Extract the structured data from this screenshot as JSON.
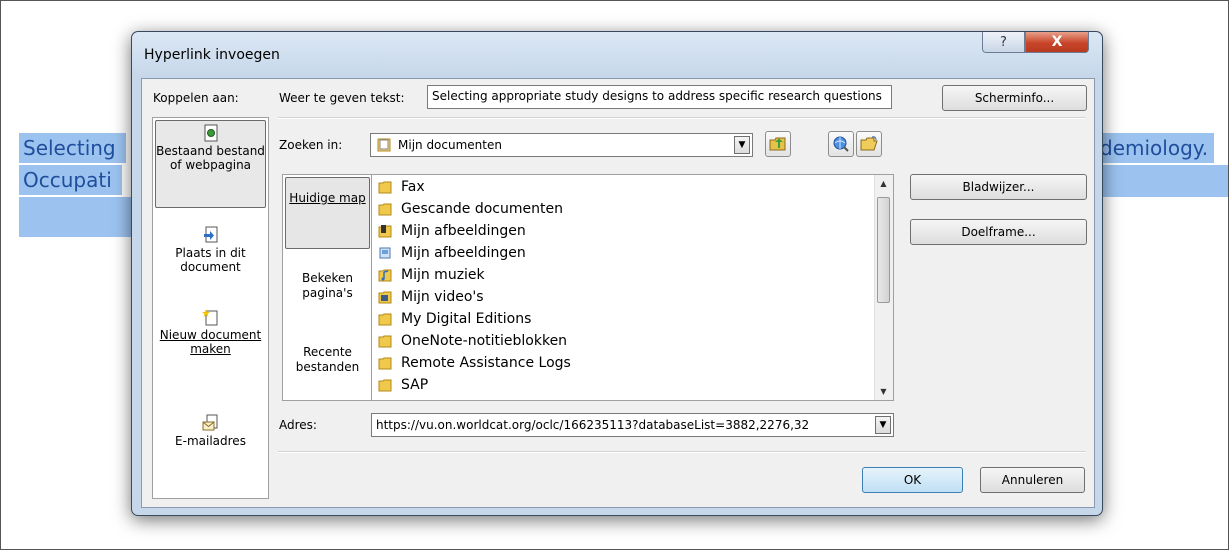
{
  "document": {
    "line1_left": "Selecting",
    "line1_right": "demiology.",
    "line2_left": "Occupati"
  },
  "dialog": {
    "title": "Hyperlink invoegen",
    "help_glyph": "?",
    "close_glyph": "X",
    "link_to_label": "Koppelen aan:",
    "link_bar": [
      {
        "label": "Bestaand bestand of webpagina",
        "icon": "existing-file-icon"
      },
      {
        "label": "Plaats in dit document",
        "icon": "place-in-document-icon"
      },
      {
        "label": "Nieuw document maken",
        "icon": "new-document-icon"
      },
      {
        "label": "E-mailadres",
        "icon": "email-icon"
      }
    ],
    "display_text_label": "Weer te geven tekst:",
    "display_text_value": "Selecting appropriate study designs to address specific research questions",
    "screentip_button": "Scherminfo...",
    "look_in_label": "Zoeken in:",
    "look_in_value": "Mijn documenten",
    "nav": [
      {
        "label": "Huidige map"
      },
      {
        "label": "Bekeken pagina's"
      },
      {
        "label": "Recente bestanden"
      }
    ],
    "files": [
      {
        "name": "Fax",
        "icon": "folder-icon"
      },
      {
        "name": "Gescande documenten",
        "icon": "folder-icon"
      },
      {
        "name": "Mijn afbeeldingen",
        "icon": "pictures-folder-icon"
      },
      {
        "name": "Mijn afbeeldingen",
        "icon": "pictures-library-icon"
      },
      {
        "name": "Mijn muziek",
        "icon": "music-folder-icon"
      },
      {
        "name": "Mijn video's",
        "icon": "video-folder-icon"
      },
      {
        "name": "My Digital Editions",
        "icon": "folder-icon"
      },
      {
        "name": "OneNote-notitieblokken",
        "icon": "folder-icon"
      },
      {
        "name": "Remote Assistance Logs",
        "icon": "folder-icon"
      },
      {
        "name": "SAP",
        "icon": "folder-icon"
      }
    ],
    "bookmark_button": "Bladwijzer...",
    "target_frame_button": "Doelframe...",
    "address_label": "Adres:",
    "address_value": "https://vu.on.worldcat.org/oclc/166235113?databaseList=3882,2276,32",
    "ok_button": "OK",
    "cancel_button": "Annuleren",
    "colors": {
      "title_bar": "#c6d7ea",
      "close": "#c8452a",
      "selection": "#9cc3f0"
    }
  }
}
